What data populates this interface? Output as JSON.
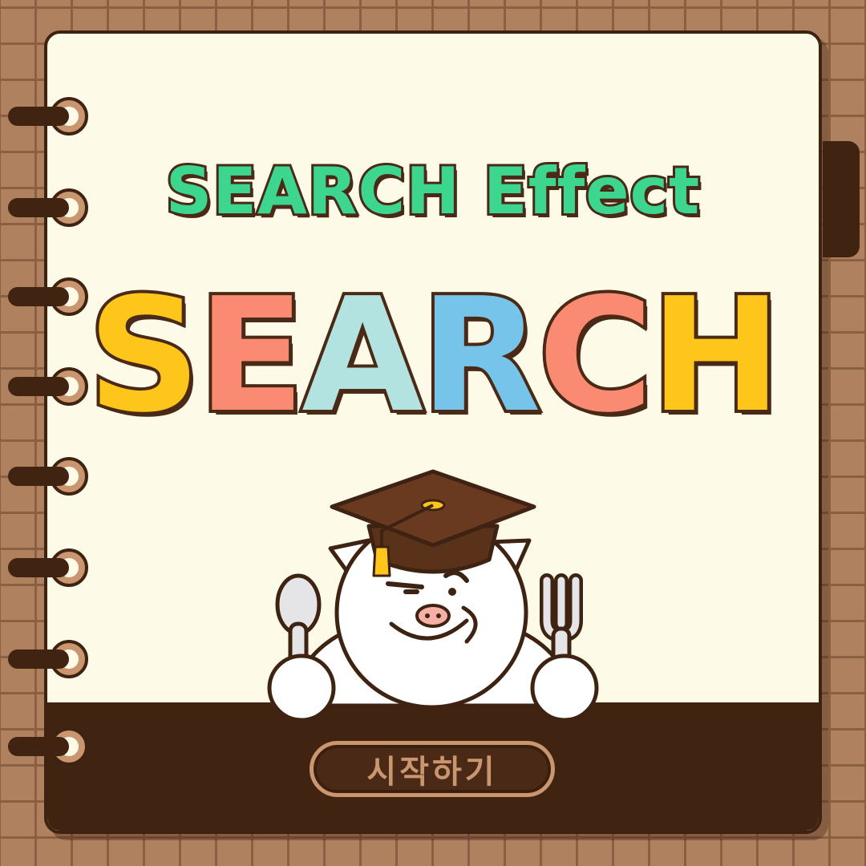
{
  "title": "SEARCH Effect",
  "big_word": [
    {
      "letter": "S",
      "color": "#fec51a"
    },
    {
      "letter": "E",
      "color": "#fa8b72"
    },
    {
      "letter": "A",
      "color": "#b3e3e0"
    },
    {
      "letter": "R",
      "color": "#76c4ea"
    },
    {
      "letter": "C",
      "color": "#fa8b72"
    },
    {
      "letter": "H",
      "color": "#fec51a"
    }
  ],
  "start_button": {
    "label": "시작하기"
  },
  "mascot": {
    "name": "pig-with-graduation-cap",
    "props": [
      "spoon-icon",
      "fork-icon"
    ]
  },
  "colors": {
    "background": "#b0815e",
    "grid": "#8a5f42",
    "page": "#fdfbe8",
    "footer": "#412312",
    "title": "#3cd68e",
    "outline": "#4a2a16"
  }
}
